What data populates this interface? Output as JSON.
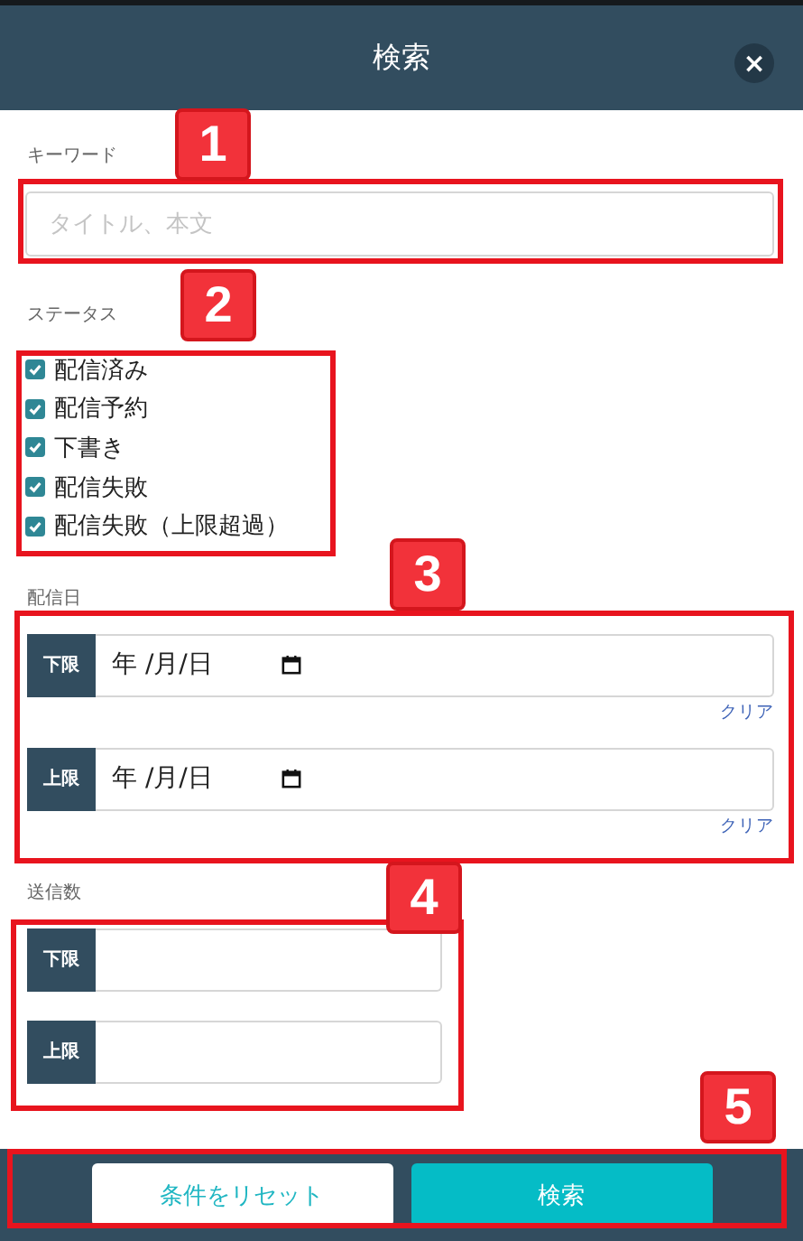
{
  "header": {
    "title": "検索",
    "close_label": "×"
  },
  "keyword": {
    "label": "キーワード",
    "placeholder": "タイトル、本文"
  },
  "status": {
    "label": "ステータス",
    "options": [
      {
        "label": "配信済み",
        "checked": true
      },
      {
        "label": "配信予約",
        "checked": true
      },
      {
        "label": "下書き",
        "checked": true
      },
      {
        "label": "配信失敗",
        "checked": true
      },
      {
        "label": "配信失敗（上限超過）",
        "checked": true
      }
    ]
  },
  "delivery_date": {
    "label": "配信日",
    "ranges": [
      {
        "prefix": "下限",
        "value": "年 /月/日",
        "clear": "クリア"
      },
      {
        "prefix": "上限",
        "value": "年 /月/日",
        "clear": "クリア"
      }
    ]
  },
  "send_count": {
    "label": "送信数",
    "ranges": [
      {
        "prefix": "下限"
      },
      {
        "prefix": "上限"
      }
    ]
  },
  "footer": {
    "buttons": [
      {
        "label": "条件をリセット",
        "kind": "secondary"
      },
      {
        "label": "検索",
        "kind": "primary"
      }
    ]
  },
  "annotations": [
    {
      "label": "1"
    },
    {
      "label": "2"
    },
    {
      "label": "3"
    },
    {
      "label": "4"
    },
    {
      "label": "5"
    }
  ]
}
